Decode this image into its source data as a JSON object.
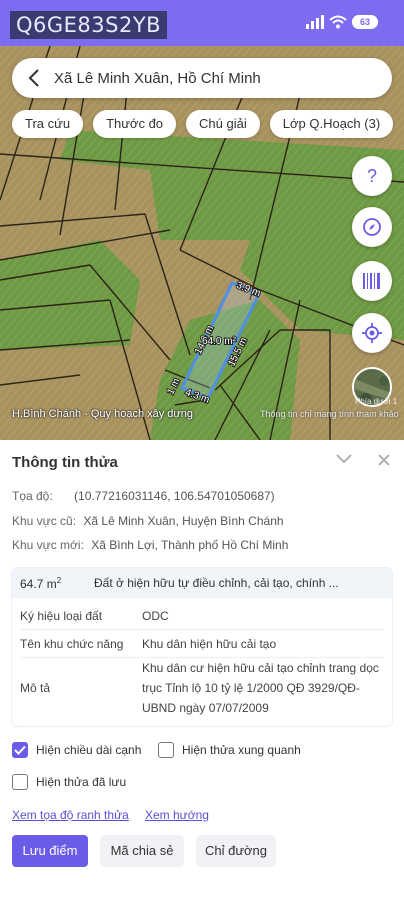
{
  "status_bar": {
    "code_watermark": "Q6GE83S2YB",
    "battery": "63",
    "battery_level": 0.63
  },
  "search": {
    "location_text": "Xã Lê Minh Xuân, Hồ Chí Minh"
  },
  "chips": [
    "Tra cứu",
    "Thước đo",
    "Chú giải",
    "Lớp Q.Hoạch (3)"
  ],
  "map": {
    "caption": "H.Bình Chánh - Quy hoạch xây dựng",
    "note": "Thông tin chỉ mang tính tham khảo",
    "sat_label": "Phía dưới 1",
    "parcel_labels": {
      "top": "3.9 m",
      "left_long": "14.9 m",
      "area": "64.0 m²",
      "right": "15.5 m",
      "left_short": "1 m",
      "bottom": "4.3 m"
    }
  },
  "panel": {
    "title": "Thông tin thửa",
    "coords_label": "Tọa độ:",
    "coords_value": "(10.77216031146, 106.54701050687)",
    "old_area_label": "Khu vực cũ:",
    "old_area_value": "Xã Lê Minh Xuân, Huyện Bình Chánh",
    "new_area_label": "Khu vực mới:",
    "new_area_value": "Xã Bình Lợi, Thành phố Hồ Chí Minh",
    "land": {
      "area_value": "64.7 m",
      "area_unit_sup": "2",
      "description": "Đất ở hiện hữu tự điều chỉnh, cải tạo, chính ...",
      "symbol_label": "Ký hiệu loại đất",
      "symbol_value": "ODC",
      "zone_label": "Tên khu chức năng",
      "zone_value": "Khu dân hiện hữu cải tạo",
      "desc_label": "Mô tả",
      "desc_value": "Khu dân cư hiện hữu cải tạo chỉnh trang dọc trục Tỉnh lộ 10 tỷ lệ 1/2000 QĐ 3929/QĐ-UBND ngày 07/07/2009"
    },
    "checkboxes": [
      {
        "label": "Hiện chiều dài cạnh",
        "checked": true
      },
      {
        "label": "Hiện thửa xung quanh",
        "checked": false
      },
      {
        "label": "Hiện thửa đã lưu",
        "checked": false
      }
    ],
    "links": {
      "boundary_coords": "Xem tọa độ ranh thửa",
      "direction": "Xem hướng"
    },
    "buttons": {
      "save_point": "Lưu điểm",
      "share_code": "Mã chia sẻ",
      "directions": "Chỉ đường"
    }
  },
  "colors": {
    "accent": "#6b5ce7",
    "status_bar": "#7b6cf0",
    "map_base": "#a48f5f",
    "map_green": "#6f9a45",
    "parcel_outline": "#4f8fe6"
  }
}
